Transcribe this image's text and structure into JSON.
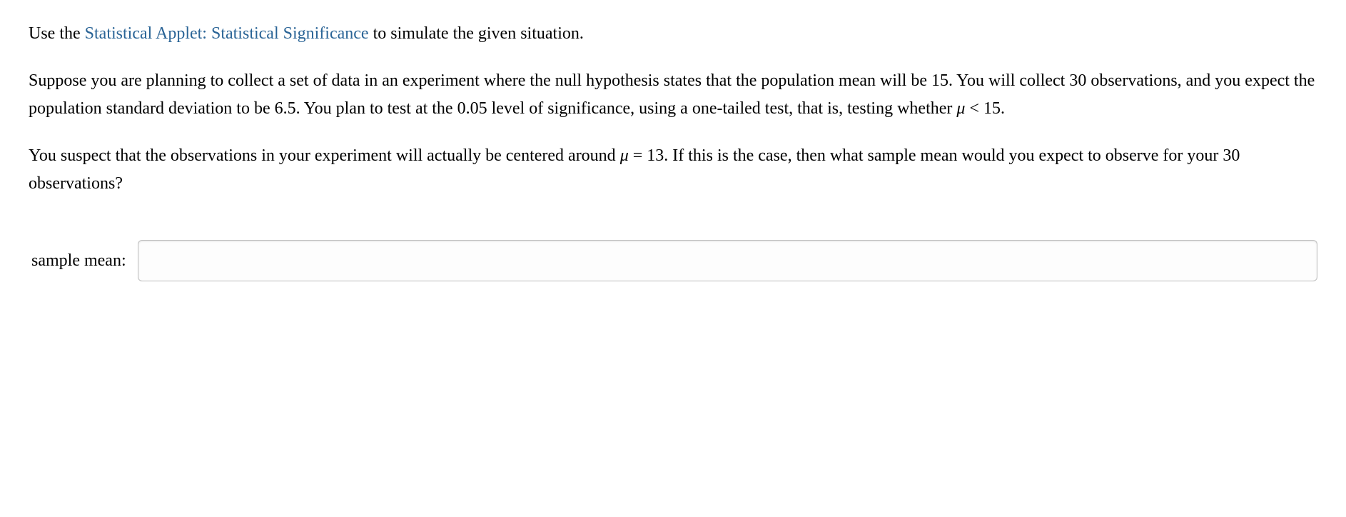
{
  "para1": {
    "pre": "Use the ",
    "link": "Statistical Applet: Statistical Significance",
    "post": " to simulate the given situation."
  },
  "para2": {
    "segA": "Suppose you are planning to collect a set of data in an experiment where the null hypothesis states that the population mean will be 15. You will collect 30 observations, and you expect the population standard deviation to be 6.5. You plan to test at the 0.05 level of significance, using a one-tailed test, that is, testing whether ",
    "mu": "μ",
    "lt": " < ",
    "val": "15",
    "period": "."
  },
  "para3": {
    "segA": "You suspect that the observations in your experiment will actually be centered around ",
    "mu": "μ",
    "eq": " = ",
    "val": "13",
    "segB": ". If this is the case, then what sample mean would you expect to observe for your 30 observations?"
  },
  "answer": {
    "label": "sample mean:",
    "value": ""
  }
}
